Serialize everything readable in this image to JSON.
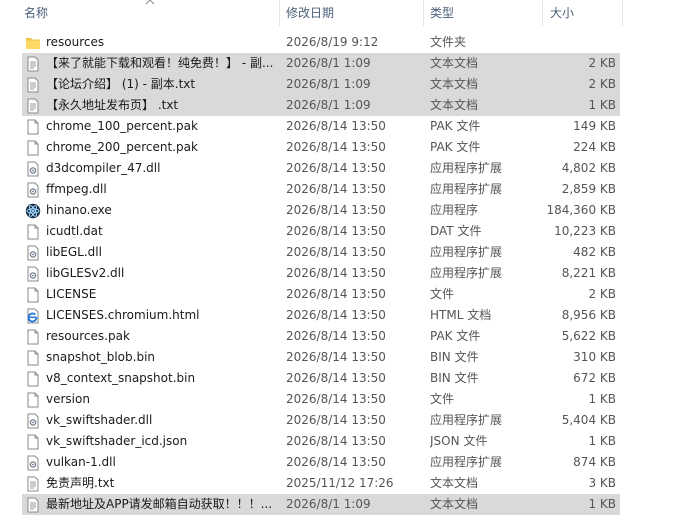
{
  "columns": {
    "name": "名称",
    "date": "修改日期",
    "type": "类型",
    "size": "大小"
  },
  "files": [
    {
      "name": "resources",
      "date": "2026/8/19 9:12",
      "type": "文件夹",
      "size": "",
      "icon": "folder-icon",
      "selected": false
    },
    {
      "name": "【来了就能下载和观看！纯免费！】 - 副...",
      "date": "2026/8/1 1:09",
      "type": "文本文档",
      "size": "2 KB",
      "icon": "text-file-icon",
      "selected": true
    },
    {
      "name": "【论坛介绍】 (1) - 副本.txt",
      "date": "2026/8/1 1:09",
      "type": "文本文档",
      "size": "2 KB",
      "icon": "text-file-icon",
      "selected": true
    },
    {
      "name": "【永久地址发布页】 .txt",
      "date": "2026/8/1 1:09",
      "type": "文本文档",
      "size": "1 KB",
      "icon": "text-file-icon",
      "selected": true
    },
    {
      "name": "chrome_100_percent.pak",
      "date": "2026/8/14 13:50",
      "type": "PAK 文件",
      "size": "149 KB",
      "icon": "file-icon",
      "selected": false
    },
    {
      "name": "chrome_200_percent.pak",
      "date": "2026/8/14 13:50",
      "type": "PAK 文件",
      "size": "224 KB",
      "icon": "file-icon",
      "selected": false
    },
    {
      "name": "d3dcompiler_47.dll",
      "date": "2026/8/14 13:50",
      "type": "应用程序扩展",
      "size": "4,802 KB",
      "icon": "dll-icon",
      "selected": false
    },
    {
      "name": "ffmpeg.dll",
      "date": "2026/8/14 13:50",
      "type": "应用程序扩展",
      "size": "2,859 KB",
      "icon": "dll-icon",
      "selected": false
    },
    {
      "name": "hinano.exe",
      "date": "2026/8/14 13:50",
      "type": "应用程序",
      "size": "184,360 KB",
      "icon": "exe-icon",
      "selected": false
    },
    {
      "name": "icudtl.dat",
      "date": "2026/8/14 13:50",
      "type": "DAT 文件",
      "size": "10,223 KB",
      "icon": "file-icon",
      "selected": false
    },
    {
      "name": "libEGL.dll",
      "date": "2026/8/14 13:50",
      "type": "应用程序扩展",
      "size": "482 KB",
      "icon": "dll-icon",
      "selected": false
    },
    {
      "name": "libGLESv2.dll",
      "date": "2026/8/14 13:50",
      "type": "应用程序扩展",
      "size": "8,221 KB",
      "icon": "dll-icon",
      "selected": false
    },
    {
      "name": "LICENSE",
      "date": "2026/8/14 13:50",
      "type": "文件",
      "size": "2 KB",
      "icon": "file-icon",
      "selected": false
    },
    {
      "name": "LICENSES.chromium.html",
      "date": "2026/8/14 13:50",
      "type": "HTML 文档",
      "size": "8,956 KB",
      "icon": "html-icon",
      "selected": false
    },
    {
      "name": "resources.pak",
      "date": "2026/8/14 13:50",
      "type": "PAK 文件",
      "size": "5,622 KB",
      "icon": "file-icon",
      "selected": false
    },
    {
      "name": "snapshot_blob.bin",
      "date": "2026/8/14 13:50",
      "type": "BIN 文件",
      "size": "310 KB",
      "icon": "file-icon",
      "selected": false
    },
    {
      "name": "v8_context_snapshot.bin",
      "date": "2026/8/14 13:50",
      "type": "BIN 文件",
      "size": "672 KB",
      "icon": "file-icon",
      "selected": false
    },
    {
      "name": "version",
      "date": "2026/8/14 13:50",
      "type": "文件",
      "size": "1 KB",
      "icon": "file-icon",
      "selected": false
    },
    {
      "name": "vk_swiftshader.dll",
      "date": "2026/8/14 13:50",
      "type": "应用程序扩展",
      "size": "5,404 KB",
      "icon": "dll-icon",
      "selected": false
    },
    {
      "name": "vk_swiftshader_icd.json",
      "date": "2026/8/14 13:50",
      "type": "JSON 文件",
      "size": "1 KB",
      "icon": "file-icon",
      "selected": false
    },
    {
      "name": "vulkan-1.dll",
      "date": "2026/8/14 13:50",
      "type": "应用程序扩展",
      "size": "874 KB",
      "icon": "dll-icon",
      "selected": false
    },
    {
      "name": "免责声明.txt",
      "date": "2025/11/12 17:26",
      "type": "文本文档",
      "size": "3 KB",
      "icon": "text-file-icon",
      "selected": false
    },
    {
      "name": "最新地址及APP请发邮箱自动获取！！！...",
      "date": "2026/8/1 1:09",
      "type": "文本文档",
      "size": "1 KB",
      "icon": "text-file-icon",
      "selected": true
    }
  ]
}
